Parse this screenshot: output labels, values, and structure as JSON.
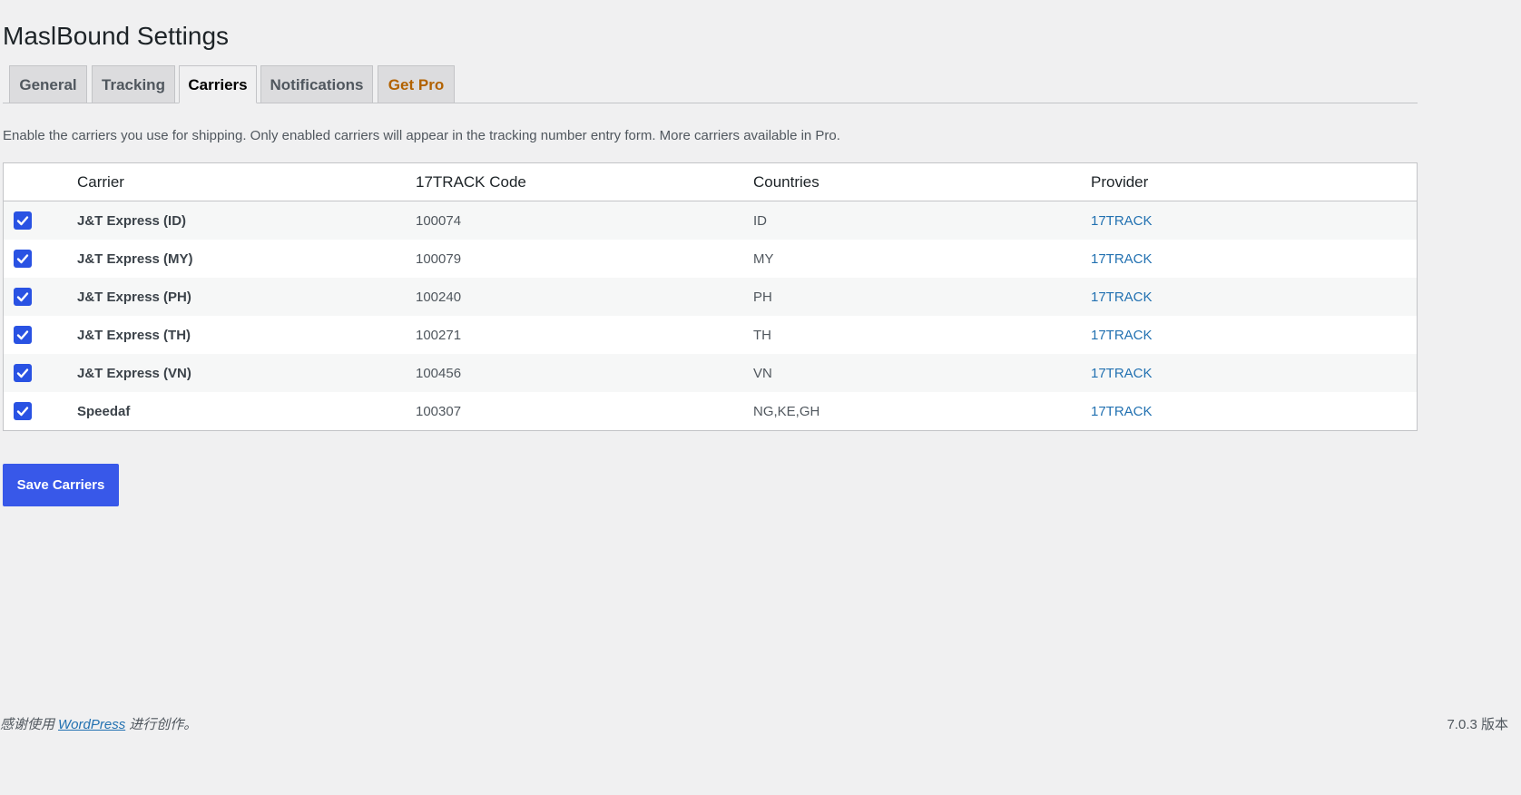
{
  "page": {
    "title": "MaslBound Settings"
  },
  "tabs": [
    {
      "label": "General",
      "active": false
    },
    {
      "label": "Tracking",
      "active": false
    },
    {
      "label": "Carriers",
      "active": true
    },
    {
      "label": "Notifications",
      "active": false
    },
    {
      "label": "Get Pro",
      "active": false,
      "color": "#b26200"
    }
  ],
  "description": "Enable the carriers you use for shipping. Only enabled carriers will appear in the tracking number entry form. More carriers available in Pro.",
  "table": {
    "columns": [
      "Carrier",
      "17TRACK Code",
      "Countries",
      "Provider"
    ],
    "rows": [
      {
        "enabled": true,
        "carrier": "J&T Express (ID)",
        "code": "100074",
        "countries": "ID",
        "provider": "17TRACK"
      },
      {
        "enabled": true,
        "carrier": "J&T Express (MY)",
        "code": "100079",
        "countries": "MY",
        "provider": "17TRACK"
      },
      {
        "enabled": true,
        "carrier": "J&T Express (PH)",
        "code": "100240",
        "countries": "PH",
        "provider": "17TRACK"
      },
      {
        "enabled": true,
        "carrier": "J&T Express (TH)",
        "code": "100271",
        "countries": "TH",
        "provider": "17TRACK"
      },
      {
        "enabled": true,
        "carrier": "J&T Express (VN)",
        "code": "100456",
        "countries": "VN",
        "provider": "17TRACK"
      },
      {
        "enabled": true,
        "carrier": "Speedaf",
        "code": "100307",
        "countries": "NG,KE,GH",
        "provider": "17TRACK"
      }
    ]
  },
  "save_button_label": "Save Carriers",
  "footer": {
    "thanks_prefix": "感谢使用",
    "wordpress_link": "WordPress",
    "thanks_suffix": "进行创作。",
    "version": "7.0.3 版本"
  },
  "colors": {
    "accent": "#3858e9",
    "link": "#2271b1",
    "pro": "#b26200",
    "background": "#f0f0f1"
  }
}
